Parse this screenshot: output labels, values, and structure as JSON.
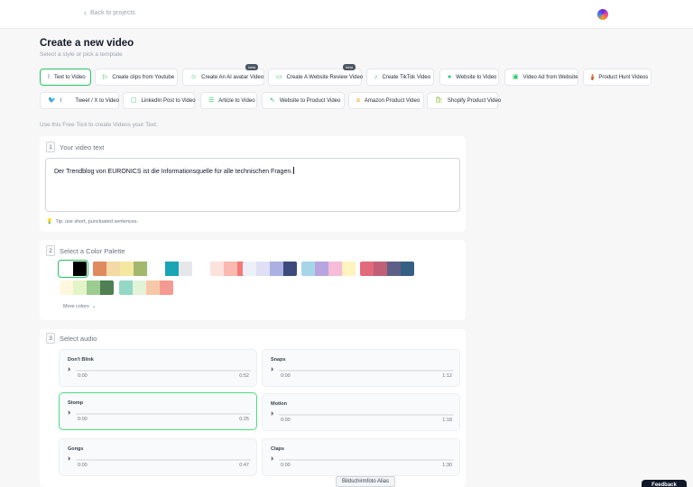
{
  "header": {
    "back_label": "Back to projects"
  },
  "page": {
    "title": "Create a new video",
    "subtitle": "Select a style or pick a template"
  },
  "templates": [
    {
      "label": "Text to Video",
      "icon": "text-cursor-icon"
    },
    {
      "label": "Create clips from Youtube",
      "icon": "play-icon"
    },
    {
      "label": "Create An AI avatar Video",
      "icon": "avatar-icon",
      "badge": "beta"
    },
    {
      "label": "Create A Website Review Video",
      "icon": "monitor-icon",
      "badge": "beta"
    },
    {
      "label": "Create TikTok Video",
      "icon": "tiktok-icon"
    },
    {
      "label": "Website to Video",
      "icon": "globe-icon"
    },
    {
      "label": "Video Ad from Website",
      "icon": "megaphone-icon"
    },
    {
      "label": "Product Hunt Videos",
      "icon": "product-hunt-icon"
    },
    {
      "label": "Tweet / X to Video",
      "icon": "twitter-icon",
      "prefix": "/"
    },
    {
      "label": "LinkedIn Post to Video",
      "icon": "linkedin-icon"
    },
    {
      "label": "Article to Video",
      "icon": "article-icon"
    },
    {
      "label": "Website to Product Video",
      "icon": "cursor-icon"
    },
    {
      "label": "Amazon Product Video",
      "icon": "amazon-icon"
    },
    {
      "label": "Shopify Product Video",
      "icon": "shopify-icon"
    }
  ],
  "intro_text": "Use this Free Tool to create Videos your Text.",
  "step1": {
    "number": "1",
    "title": "Your video text",
    "text": "Der Trendblog von EURONICS ist die Informationsquelle für alle technischen Fragen.",
    "tip": "Tip: use short, punctuated sentences."
  },
  "step2": {
    "number": "2",
    "title": "Select a Color Palette",
    "more_label": "More colors",
    "palettes": [
      [
        "#ffffff",
        "#000000"
      ],
      [
        "#e08a5f",
        "#f3d9a4",
        "#f4e7a2",
        "#a3b86c",
        "#f9fafb"
      ],
      [
        "#ffffff",
        "#1aa4b4",
        "#e5e7eb"
      ],
      [
        "#ffffff",
        "#fde2dc",
        "#f9b8b0",
        "#f27a7a"
      ],
      [
        "#eef0f8",
        "#dfe0f5",
        "#aab0e1",
        "#3c4a7d"
      ],
      [
        "#a6d5e8",
        "#b7a5e0",
        "#f6bcd8",
        "#fff3c0"
      ],
      [
        "#e26a7a",
        "#c06078",
        "#5e5f86",
        "#365f84"
      ],
      [
        "#fff8df",
        "#e4f4c8",
        "#9ccc92",
        "#4f7f52"
      ],
      [
        "#93d8c6",
        "#e3f3d8",
        "#f7c8a8",
        "#f59a93"
      ]
    ]
  },
  "step3": {
    "number": "3",
    "title": "Select audio",
    "tracks": [
      {
        "name": "Don't Blink",
        "start": "0:00",
        "end": "0:52"
      },
      {
        "name": "Snaps",
        "start": "0:00",
        "end": "1:12"
      },
      {
        "name": "Stomp",
        "start": "0:00",
        "end": "0:25",
        "selected": true
      },
      {
        "name": "Motion",
        "start": "0:00",
        "end": "1:18"
      },
      {
        "name": "Gongs",
        "start": "0:00",
        "end": "0:47"
      },
      {
        "name": "Claps",
        "start": "0:00",
        "end": "1:30"
      }
    ]
  },
  "overlay_label": "Bildschirmfoto Alias",
  "feedback_label": "Feedback",
  "colors": {
    "accent": "#22c55e",
    "text": "#1f2937",
    "muted": "#9ca3af"
  }
}
